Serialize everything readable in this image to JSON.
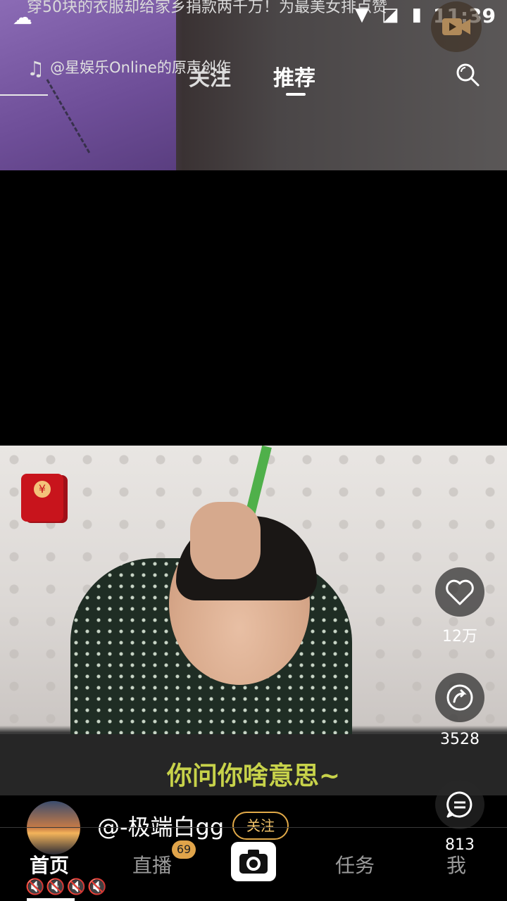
{
  "status_bar": {
    "headline": "穿50块的衣服却给家乡捐款两千万！为最美女排点赞",
    "time": "11:39",
    "icons": [
      "wifi-icon",
      "no-sim-icon",
      "battery-charging-icon"
    ]
  },
  "top_bar": {
    "music_credit": "@星娱乐Online的原声创作",
    "tabs": [
      {
        "label": "关注",
        "active": false
      },
      {
        "label": "推荐",
        "active": true
      }
    ]
  },
  "video": {
    "subtitle": "你问你啥意思~"
  },
  "actions": {
    "likes": "12万",
    "shares": "3528",
    "comments": "813"
  },
  "author": {
    "username": "@-极端白gg",
    "follow_label": "关注"
  },
  "bottom_nav": {
    "home": "首页",
    "live": "直播",
    "live_badge": "69",
    "tasks": "任务",
    "me": "我"
  },
  "colors": {
    "accent": "#e1a948",
    "subtitle": "#c7d24a"
  }
}
